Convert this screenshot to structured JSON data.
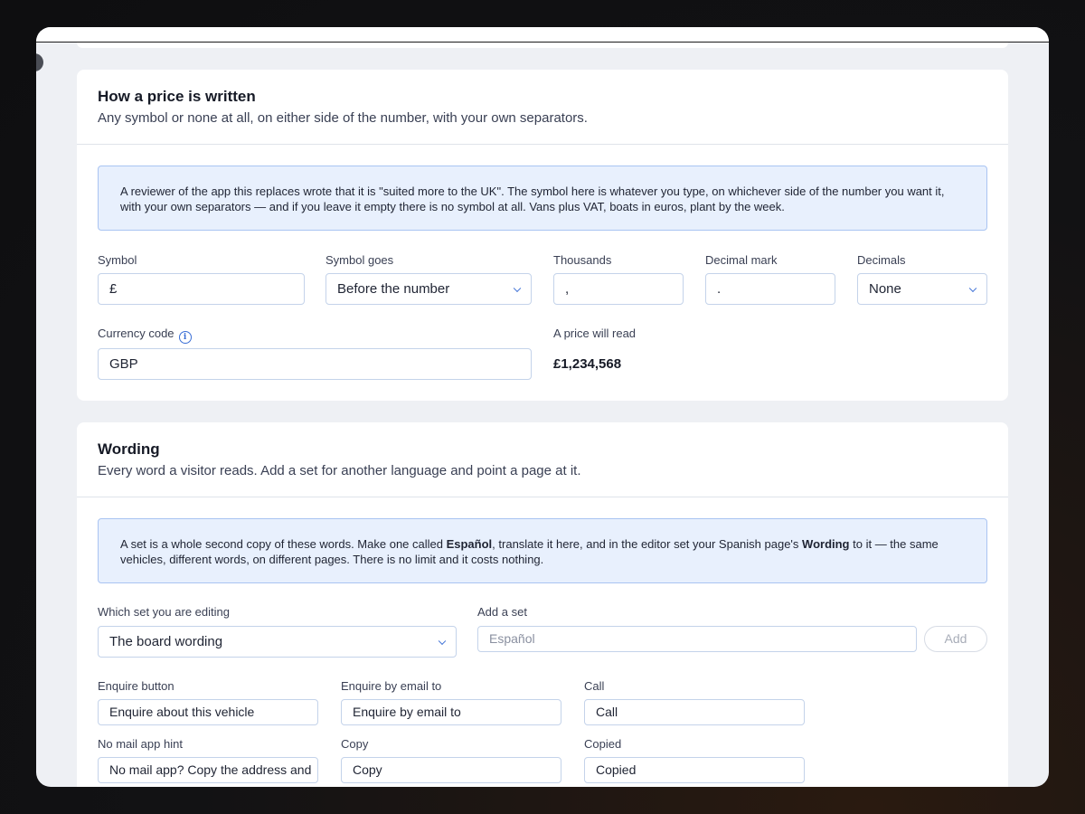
{
  "price_card": {
    "title": "How a price is written",
    "subtitle": "Any symbol or none at all, on either side of the number, with your own separators.",
    "note": "A reviewer of the app this replaces wrote that it is \"suited more to the UK\". The symbol here is whatever you type, on whichever side of the number you want it, with your own separators — and if you leave it empty there is no symbol at all. Vans plus VAT, boats in euros, plant by the week.",
    "symbol_label": "Symbol",
    "symbol_value": "£",
    "symbol_goes_label": "Symbol goes",
    "symbol_goes_value": "Before the number",
    "thousands_label": "Thousands",
    "thousands_value": ",",
    "decimal_mark_label": "Decimal mark",
    "decimal_mark_value": ".",
    "decimals_label": "Decimals",
    "decimals_value": "None",
    "currency_code_label": "Currency code",
    "currency_code_value": "GBP",
    "preview_label": "A price will read",
    "preview_value": "£1,234,568"
  },
  "wording_card": {
    "title": "Wording",
    "subtitle": "Every word a visitor reads. Add a set for another language and point a page at it.",
    "note_part1": "A set is a whole second copy of these words. Make one called ",
    "note_bold1": "Español",
    "note_part2": ", translate it here, and in the editor set your Spanish page's ",
    "note_bold2": "Wording",
    "note_part3": " to it — the same vehicles, different words, on different pages. There is no limit and it costs nothing.",
    "set_label": "Which set you are editing",
    "set_value": "The board wording",
    "add_set_label": "Add a set",
    "add_set_placeholder": "Español",
    "add_button": "Add",
    "fields": [
      {
        "label": "Enquire button",
        "value": "Enquire about this vehicle"
      },
      {
        "label": "Enquire by email to",
        "value": "Enquire by email to"
      },
      {
        "label": "Call",
        "value": "Call"
      },
      {
        "label": "No mail app hint",
        "value": "No mail app? Copy the address and"
      },
      {
        "label": "Copy",
        "value": "Copy"
      },
      {
        "label": "Copied",
        "value": "Copied"
      }
    ]
  },
  "colors": {
    "accent": "#3b6fd6",
    "note_bg": "#e8f0fd",
    "page_bg": "#eef0f4"
  },
  "icons": {
    "info": "info-icon",
    "chevron": "chevron-down-icon"
  }
}
